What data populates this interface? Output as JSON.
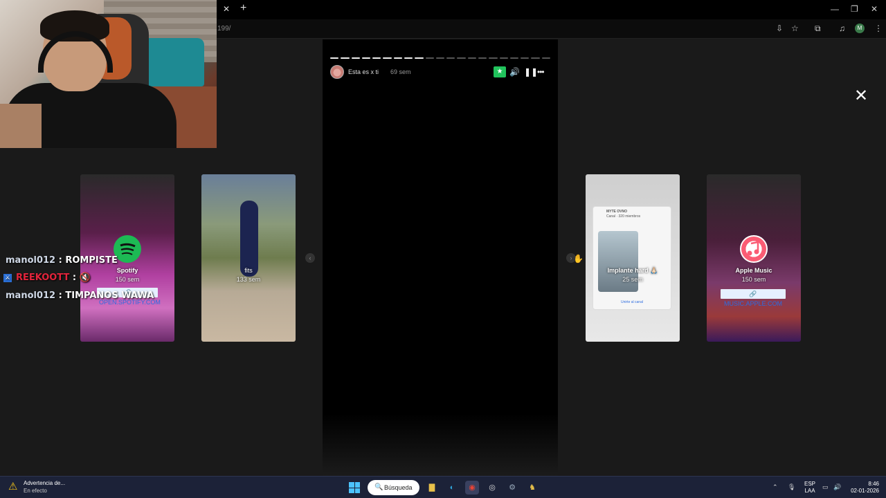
{
  "browser": {
    "tab_close": "✕",
    "new_tab": "+",
    "url_fragment": "199/",
    "window_controls": [
      "—",
      "❐",
      "✕"
    ],
    "toolbar_icons": [
      "install-icon",
      "star-icon",
      "extensions-icon",
      "media-icon",
      "profile-avatar",
      "kebab-menu-icon"
    ],
    "profile_initial": "M"
  },
  "story": {
    "username": "Esta es x ti",
    "time": "69 sem",
    "progress": {
      "total": 21,
      "viewed": 9
    },
    "controls": [
      "close-friends-star",
      "volume",
      "pause",
      "more"
    ],
    "close_glyph": "✕"
  },
  "cards": [
    {
      "title": "Spotify",
      "time": "150 sem",
      "link": "OPEN.SPOTIFY.COM",
      "accent": "#1db954"
    },
    {
      "title": "fits",
      "time": "133 sem"
    },
    {
      "title": "Implante hard 🙏🏻",
      "time": "25 sem",
      "inner_header": "MYTE OVNO",
      "inner_sub": "Canal · 320 miembros",
      "inner_footer": "Unirte al canal"
    },
    {
      "title": "Apple Music",
      "time": "150 sem",
      "link": "MUSIC.APPLE.COM",
      "accent": "#fb5c74"
    }
  ],
  "chat": [
    {
      "user": "manol012",
      "message": "ROMPISTE",
      "user_color": "#cfd8e6",
      "badge": false
    },
    {
      "user": "REEKOOTT",
      "message": "🔇",
      "user_color": "#e3243b",
      "badge": true
    },
    {
      "user": "manol012",
      "message": "TIMPANOS WAWA",
      "user_color": "#cfd8e6",
      "badge": false
    }
  ],
  "taskbar": {
    "warning_title": "Advertencia de...",
    "warning_subtitle": "En efecto",
    "search_label": "Búsqueda",
    "apps": [
      "windows-start-icon",
      "search",
      "file-explorer-icon",
      "edge-icon",
      "chrome-icon",
      "obs-icon",
      "settings-icon",
      "app-icon"
    ],
    "language_top": "ESP",
    "language_bottom": "LAA",
    "time": "8:46",
    "date": "02-01-2026"
  }
}
